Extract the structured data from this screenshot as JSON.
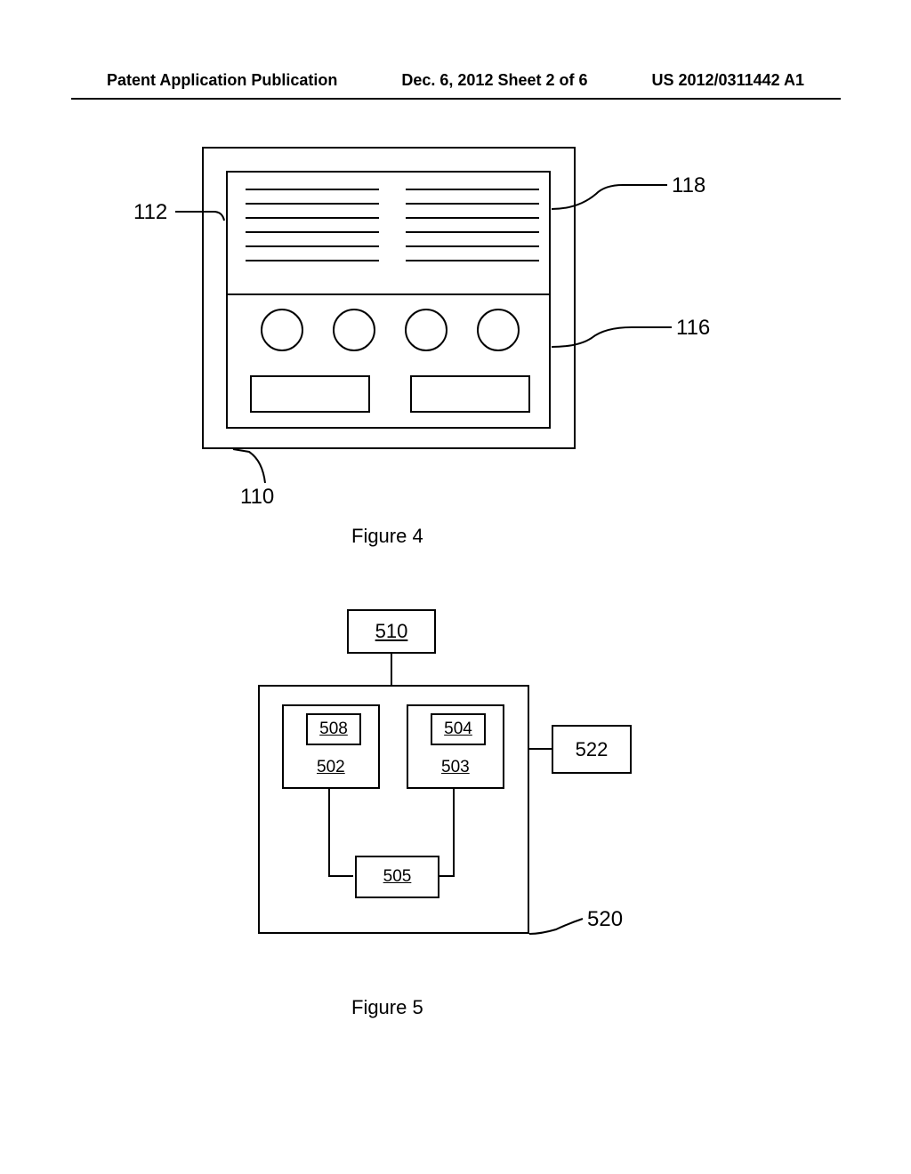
{
  "header": {
    "left": "Patent Application Publication",
    "center": "Dec. 6, 2012  Sheet 2 of 6",
    "right": "US 2012/0311442 A1"
  },
  "figure4": {
    "caption": "Figure 4",
    "labels": {
      "ref_112": "112",
      "ref_118": "118",
      "ref_116": "116",
      "ref_110": "110"
    }
  },
  "figure5": {
    "caption": "Figure 5",
    "labels": {
      "ref_510": "510",
      "ref_508": "508",
      "ref_504": "504",
      "ref_502": "502",
      "ref_503": "503",
      "ref_505": "505",
      "ref_522": "522",
      "ref_520": "520"
    }
  }
}
